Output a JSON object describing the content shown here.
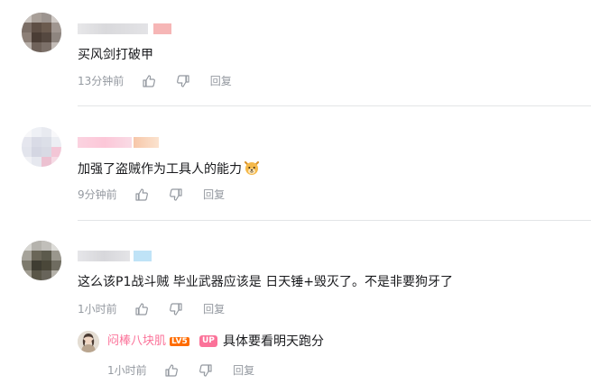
{
  "comments": [
    {
      "text": "买风剑打破甲",
      "time": "13分钟前",
      "reply_label": "回复",
      "icons": {
        "like": "thumbs-up-icon",
        "dislike": "thumbs-down-icon"
      }
    },
    {
      "text": "加强了盗贼作为工具人的能力",
      "emoji": "dog-face-emoji-icon",
      "time": "9分钟前",
      "reply_label": "回复",
      "icons": {
        "like": "thumbs-up-icon",
        "dislike": "thumbs-down-icon"
      }
    },
    {
      "text": "这么该P1战斗贼 毕业武器应该是 日天锤+毁灭了。不是非要狗牙了",
      "time": "1小时前",
      "reply_label": "回复",
      "icons": {
        "like": "thumbs-up-icon",
        "dislike": "thumbs-down-icon"
      },
      "sub_reply": {
        "username": "闷棒八块肌",
        "level": "LV5",
        "badge": "UP",
        "text": "具体要看明天跑分",
        "time": "1小时前",
        "reply_label": "回复"
      }
    }
  ],
  "colors": {
    "meta_gray": "#9499a0",
    "divider": "#e3e5e7",
    "username_pink": "#fb7299",
    "level_orange": "#ff6c00"
  }
}
